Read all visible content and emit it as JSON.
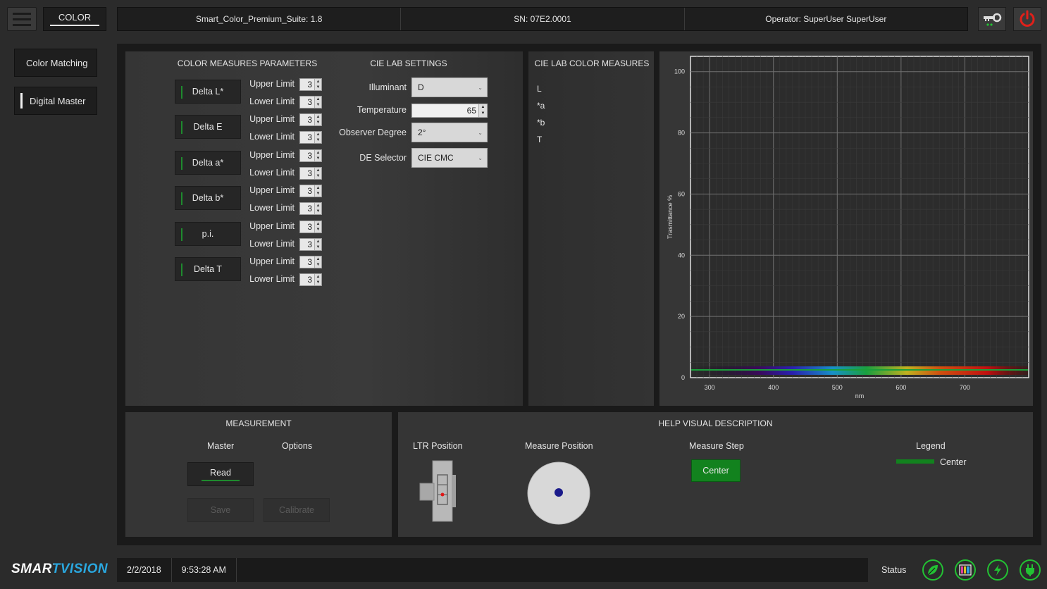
{
  "header": {
    "tab_label": "COLOR",
    "suite": "Smart_Color_Premium_Suite: 1.8",
    "serial": "SN: 07E2.0001",
    "operator": "Operator:  SuperUser SuperUser"
  },
  "sidebar": {
    "items": [
      {
        "label": "Color Matching"
      },
      {
        "label": "Digital Master"
      }
    ]
  },
  "params": {
    "title": "COLOR MEASURES PARAMETERS",
    "upper_label": "Upper Limit",
    "lower_label": "Lower Limit",
    "rows": [
      {
        "name": "Delta L*",
        "upper": "3",
        "lower": "3"
      },
      {
        "name": "Delta E",
        "upper": "3",
        "lower": "3"
      },
      {
        "name": "Delta a*",
        "upper": "3",
        "lower": "3"
      },
      {
        "name": "Delta b*",
        "upper": "3",
        "lower": "3"
      },
      {
        "name": "p.i.",
        "upper": "3",
        "lower": "3"
      },
      {
        "name": "Delta T",
        "upper": "3",
        "lower": "3"
      }
    ]
  },
  "cie_settings": {
    "title": "CIE LAB SETTINGS",
    "illuminant_label": "Illuminant",
    "illuminant_value": "D",
    "temperature_label": "Temperature",
    "temperature_value": "65",
    "observer_label": "Observer Degree",
    "observer_value": "2°",
    "de_label": "DE Selector",
    "de_value": "CIE CMC"
  },
  "cie_measures": {
    "title": "CIE LAB COLOR MEASURES",
    "items": [
      "L",
      "*a",
      "*b",
      "T"
    ]
  },
  "chart_data": {
    "type": "line",
    "title": "",
    "xlabel": "nm",
    "ylabel": "Trasmittance %",
    "xlim": [
      270,
      800
    ],
    "ylim": [
      0,
      105
    ],
    "x_ticks": [
      300,
      400,
      500,
      600,
      700
    ],
    "y_ticks": [
      0,
      20,
      40,
      60,
      80,
      100
    ],
    "grid": true,
    "series": []
  },
  "measurement": {
    "title": "MEASUREMENT",
    "master_label": "Master",
    "options_label": "Options",
    "read_label": "Read",
    "save_label": "Save",
    "calibrate_label": "Calibrate"
  },
  "help": {
    "title": "HELP VISUAL DESCRIPTION",
    "ltr_label": "LTR Position",
    "measure_pos_label": "Measure Position",
    "step_label": "Measure Step",
    "step_button": "Center",
    "legend_label": "Legend",
    "legend_item": "Center"
  },
  "footer": {
    "logo": "SMARTVISION",
    "date": "2/2/2018",
    "time": "9:53:28 AM",
    "status_label": "Status"
  },
  "colors": {
    "accent_green": "#1e8a2e",
    "status_green": "#22c233",
    "power_red": "#e0201a"
  }
}
